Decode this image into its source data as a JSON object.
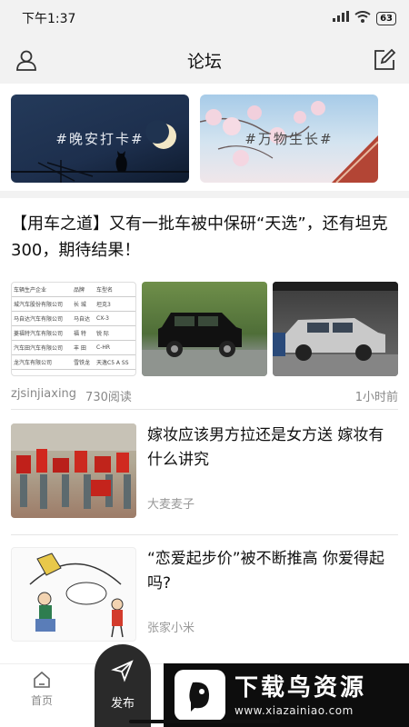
{
  "status_bar": {
    "time": "下午1:37",
    "signal_icon": "signal-icon",
    "wifi_icon": "wifi-icon",
    "battery": "63"
  },
  "top_bar": {
    "title": "论坛",
    "left_icon": "user-icon",
    "right_icon": "edit-icon"
  },
  "banners": [
    {
      "text": "#晚安打卡#",
      "theme": "night"
    },
    {
      "text": "#万物生长#",
      "theme": "blossom"
    }
  ],
  "posts": {
    "main": {
      "title": "【用车之道】又有一批车被中保研“天选”，还有坦克300，期待结果！",
      "author": "zjsinjiaxing",
      "reads": "730阅读",
      "time": "1小时前",
      "table_headers": [
        "车辆生产企业",
        "品牌",
        "车型名"
      ],
      "table_rows": [
        [
          "城汽车股份有限公司",
          "长 城",
          "坦克3"
        ],
        [
          "马自达汽车有限公司",
          "马自达",
          "CX-3"
        ],
        [
          "菱福特汽车有限公司",
          "福 特",
          "锐 际"
        ],
        [
          "汽车田汽车有限公司",
          "丰 田",
          "C-HR"
        ],
        [
          "龙汽车有限公司",
          "雪铁龙",
          "天逸C5 A SS"
        ]
      ]
    },
    "items": [
      {
        "title": "嫁妆应该男方拉还是女方送 嫁妆有什么讲究",
        "author": "大麦麦子"
      },
      {
        "title": "“恋爱起步价”被不断推高 你爱得起吗?",
        "author": "张家小米"
      }
    ]
  },
  "bottom_nav": {
    "home_label": "首页",
    "home_icon": "home-icon",
    "publish_label": "发布",
    "publish_icon": "send-icon"
  },
  "watermark": {
    "title": "下载鸟资源",
    "url": "www.xiazainiao.com"
  },
  "colors": {
    "page_bg": "#ffffff",
    "bar_bg": "#f2f2f2",
    "publish_bg": "#2a2a2a",
    "meta_text": "#888888"
  }
}
